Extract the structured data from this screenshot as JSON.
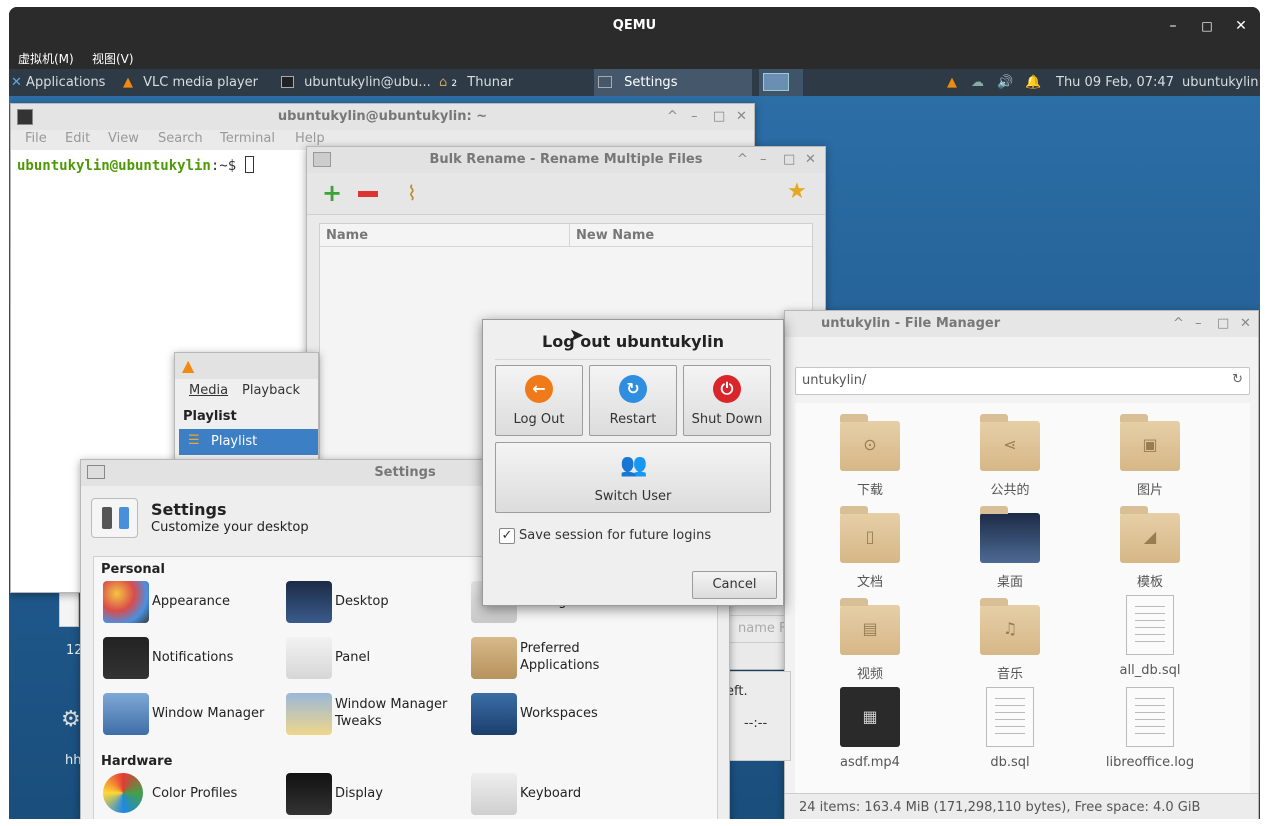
{
  "qemu": {
    "title": "QEMU",
    "menu": [
      "虚拟机(M)",
      "视图(V)"
    ],
    "controls": [
      "–",
      "□",
      "✕"
    ]
  },
  "panel": {
    "applications": "Applications",
    "tasks": [
      "VLC media player",
      "ubuntukylin@ubu...",
      "Thunar",
      "Settings"
    ],
    "thunar_badge": "2",
    "clock": "Thu 09 Feb, 07:47",
    "user": "ubuntukylin"
  },
  "terminal": {
    "title": "ubuntukylin@ubuntukylin: ~",
    "menu": [
      "File",
      "Edit",
      "View",
      "Search",
      "Terminal",
      "Help"
    ],
    "prompt_user": "ubuntukylin@ubuntukylin",
    "prompt_path": ":~$"
  },
  "bulk_rename": {
    "title": "Bulk Rename - Rename Multiple Files",
    "col_name": "Name",
    "col_new": "New Name",
    "rename_btn": "name Files",
    "left_text": "eft.",
    "time_text": "--:--"
  },
  "vlc": {
    "menu": [
      "Media",
      "Playback"
    ],
    "playlist_header": "Playlist",
    "playlist_item": "Playlist"
  },
  "file_manager": {
    "title": "untukylin - File Manager",
    "path": "untukylin/",
    "items": [
      {
        "label": "下载",
        "kind": "folder",
        "glyph": "⊙"
      },
      {
        "label": "公共的",
        "kind": "folder",
        "glyph": "⋖"
      },
      {
        "label": "图片",
        "kind": "folder",
        "glyph": "▣"
      },
      {
        "label": "文档",
        "kind": "folder",
        "glyph": "▯"
      },
      {
        "label": "桌面",
        "kind": "desktop",
        "glyph": ""
      },
      {
        "label": "模板",
        "kind": "folder",
        "glyph": "◢"
      },
      {
        "label": "视频",
        "kind": "folder",
        "glyph": "▤"
      },
      {
        "label": "音乐",
        "kind": "folder",
        "glyph": "♫"
      },
      {
        "label": "all_db.sql",
        "kind": "doc",
        "glyph": ""
      },
      {
        "label": "asdf.mp4",
        "kind": "video",
        "glyph": "▦"
      },
      {
        "label": "db.sql",
        "kind": "doc",
        "glyph": ""
      },
      {
        "label": "libreoffice.log",
        "kind": "doc",
        "glyph": ""
      }
    ],
    "status": "24 items: 163.4 MiB (171,298,110 bytes), Free space: 4.0 GiB"
  },
  "settings": {
    "title": "Settings",
    "header_title": "Settings",
    "header_sub": "Customize your desktop",
    "personal": "Personal",
    "hardware": "Hardware",
    "personal_items": [
      {
        "label": "Appearance",
        "icon": "appearance-icon"
      },
      {
        "label": "Desktop",
        "icon": "desktop-icon"
      },
      {
        "label": "Settings",
        "icon": "settings-manager-icon"
      },
      {
        "label": "Notifications",
        "icon": "notifications-icon"
      },
      {
        "label": "Panel",
        "icon": "panel-icon"
      },
      {
        "label": "Preferred\nApplications",
        "icon": "preferred-apps-icon"
      },
      {
        "label": "Window Manager",
        "icon": "window-manager-icon"
      },
      {
        "label": "Window Manager\nTweaks",
        "icon": "wm-tweaks-icon"
      },
      {
        "label": "Workspaces",
        "icon": "workspaces-icon"
      }
    ],
    "hardware_items": [
      {
        "label": "Color Profiles",
        "icon": "color-profiles-icon"
      },
      {
        "label": "Display",
        "icon": "display-icon"
      },
      {
        "label": "Keyboard",
        "icon": "keyboard-icon"
      }
    ]
  },
  "desktop": {
    "icon1_label": "12",
    "icon2_label": "hh"
  },
  "logout": {
    "title": "Log out ubuntukylin",
    "log_out": "Log Out",
    "restart": "Restart",
    "shut_down": "Shut Down",
    "switch_user": "Switch User",
    "save_session": "Save session for future logins",
    "save_session_checked": true,
    "cancel": "Cancel"
  },
  "colors": {
    "logout_orange": "#f07a1a",
    "restart_blue": "#2e8ee0",
    "shutdown_red": "#d9262b",
    "selection_blue": "#3d7fc4"
  }
}
